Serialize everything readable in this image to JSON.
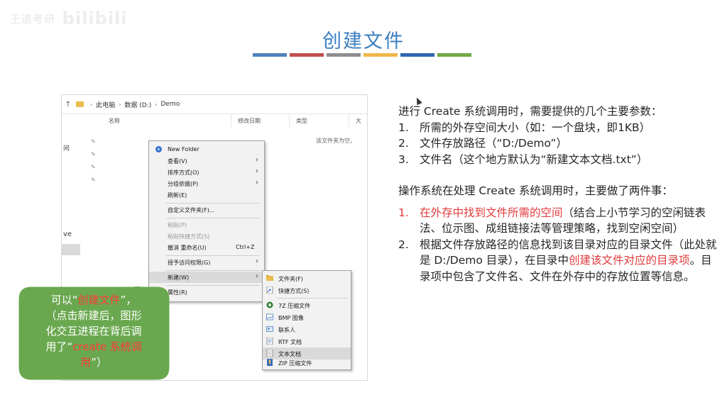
{
  "watermark": {
    "text": "王道考研",
    "brand": "bilibili"
  },
  "slide": {
    "title": "创建文件",
    "bar_colors": [
      "#4e81bd",
      "#c0504d",
      "#8e8e8e",
      "#f0b64a",
      "#2f66b3",
      "#6fa845"
    ]
  },
  "explorer": {
    "breadcrumb": [
      "此电脑",
      "数据 (D:)",
      "Demo"
    ],
    "columns": [
      "名称",
      "修改日期",
      "类型",
      "大"
    ],
    "empty_message": "该文件夹为空。",
    "nav_labels": [
      "问",
      "ve"
    ]
  },
  "context_menu": {
    "items": [
      {
        "label": "New Folder",
        "icon": "new-folder-icon"
      },
      {
        "label": "查看(V)",
        "submenu": true
      },
      {
        "label": "排序方式(O)",
        "submenu": true
      },
      {
        "label": "分组依据(P)",
        "submenu": true
      },
      {
        "label": "刷新(E)"
      },
      {
        "label": "自定义文件夹(F)..."
      },
      {
        "label": "粘贴(P)",
        "disabled": true
      },
      {
        "label": "粘贴快捷方式(S)",
        "disabled": true
      },
      {
        "label": "撤消 重命名(U)",
        "shortcut": "Ctrl+Z"
      },
      {
        "label": "授予访问权限(G)",
        "submenu": true
      },
      {
        "label": "新建(W)",
        "submenu": true
      },
      {
        "label": "属性(R)"
      }
    ]
  },
  "new_submenu": {
    "items": [
      {
        "label": "文件夹(F)",
        "icon": "folder-icon"
      },
      {
        "label": "快捷方式(S)",
        "icon": "shortcut-icon"
      },
      {
        "label": "7Z 压缩文件",
        "icon": "archive-icon"
      },
      {
        "label": "BMP 图像",
        "icon": "image-icon"
      },
      {
        "label": "联系人",
        "icon": "contact-icon"
      },
      {
        "label": "RTF 文档",
        "icon": "rtf-document-icon"
      },
      {
        "label": "文本文档",
        "icon": "text-document-icon"
      },
      {
        "label": "ZIP 压缩文件",
        "icon": "zip-icon"
      }
    ]
  },
  "callout": {
    "line1_pre": "可以“",
    "line1_red": "创建文件",
    "line1_post": "”，",
    "line2": "（点击新建后，图形",
    "line3": "化交互进程在背后调",
    "line4_pre": "用了“",
    "line4_red": "create 系统调",
    "line5_red": "用",
    "line5_post": "”）"
  },
  "content": {
    "intro": "进行 Create 系统调用时，需要提供的几个主要参数：",
    "params": [
      {
        "num": "1.",
        "text": "所需的外存空间大小（如：一个盘块，即1KB）"
      },
      {
        "num": "2.",
        "text": "文件存放路径（“D:/Demo”）"
      },
      {
        "num": "3.",
        "text": "文件名（这个地方默认为“新建文本文档.txt”）"
      }
    ],
    "process_intro": "操作系统在处理 Create 系统调用时，主要做了两件事：",
    "step1": {
      "num": "1.",
      "red": "在外存中找到文件所需的空间",
      "rest": "（结合上小节学习的空闲链表法、位示图、成组链接法等管理策略，找到空闲空间）"
    },
    "step2": {
      "num": "2.",
      "pre": "根据文件存放路径的信息找到该目录对应的目录文件（此处就是 D:/Demo 目录），在目录中",
      "red": "创建该文件对应的目录项",
      "post": "。目录项中包含了文件名、文件在外存中的存放位置等信息。"
    }
  }
}
